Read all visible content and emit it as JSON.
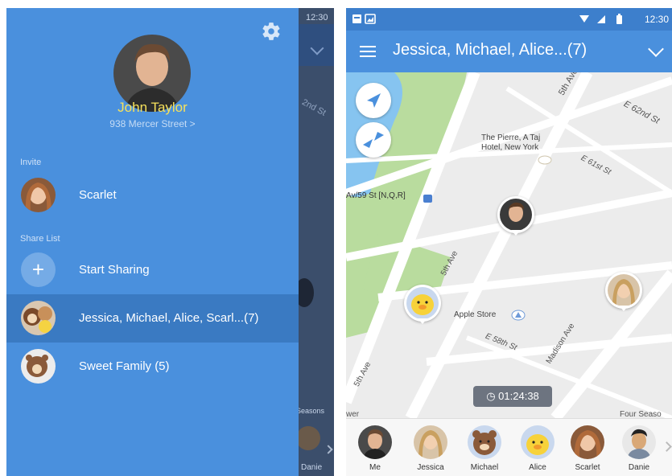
{
  "drawer": {
    "background_time": "12:30",
    "background_street": "2nd St",
    "background_season": "Seasons",
    "background_name": "Danie",
    "profile": {
      "name": "John Taylor",
      "address": "938 Mercer Street >"
    },
    "invite_label": "Invite",
    "invite_items": [
      {
        "label": "Scarlet"
      }
    ],
    "share_label": "Share List",
    "start_sharing_label": "Start Sharing",
    "share_items": [
      {
        "label": "Jessica, Michael, Alice, Scarl...(7)",
        "selected": true
      },
      {
        "label": "Sweet Family (5)",
        "selected": false
      }
    ]
  },
  "map_screen": {
    "status_time": "12:30",
    "title": "Jessica, Michael, Alice...(7)",
    "map_labels": {
      "street_5th_ave_top": "5th Ave",
      "street_e62": "E 62nd St",
      "poi_hotel": "The Pierre, A Taj Hotel, New York",
      "street_e61": "E 61st St",
      "transit": "Av/59 St [N,Q,R]",
      "street_5th_ave_mid": "5th Ave",
      "poi_apple": "Apple Store",
      "street_e58": "E 58th St",
      "street_madison": "Madison Ave",
      "street_5th_ave_bottom": "5th Ave",
      "poi_four_seasons": "Four Seaso",
      "partial_wer": "wer"
    },
    "timer": "01:24:38",
    "friends": [
      {
        "name": "Me"
      },
      {
        "name": "Jessica"
      },
      {
        "name": "Michael"
      },
      {
        "name": "Alice"
      },
      {
        "name": "Scarlet"
      },
      {
        "name": "Danie"
      }
    ]
  },
  "colors": {
    "drawer_blue": "#4a90dd",
    "selected_row": "#3a7ac2",
    "name_yellow": "#f6e15c",
    "park_green": "#b9dc9e",
    "water_blue": "#86c4f0"
  }
}
